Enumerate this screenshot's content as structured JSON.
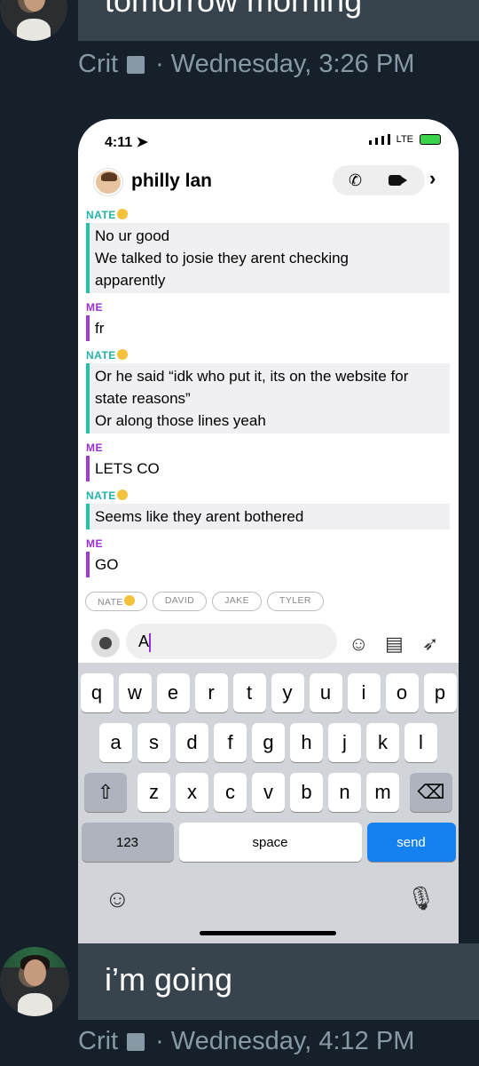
{
  "prev_message": {
    "text": "tomorrow morning"
  },
  "prev_meta": {
    "name": "Crit",
    "separator": "·",
    "timestamp": "Wednesday, 3:26 PM"
  },
  "phone": {
    "status": {
      "time": "4:11",
      "network": "LTE"
    },
    "chat": {
      "title": "philly lan"
    },
    "messages": [
      {
        "sender": "NATE",
        "lines": [
          "No ur good",
          "We talked to josie they arent checking",
          "apparently"
        ]
      },
      {
        "sender": "ME",
        "lines": [
          "fr"
        ]
      },
      {
        "sender": "NATE",
        "lines": [
          "Or he said “idk who put it, its on the website for",
          "state reasons”",
          "Or along those lines yeah"
        ]
      },
      {
        "sender": "ME",
        "lines": [
          "LETS CO"
        ]
      },
      {
        "sender": "NATE",
        "lines": [
          "Seems like they arent bothered"
        ]
      },
      {
        "sender": "ME",
        "lines": [
          "GO"
        ]
      }
    ],
    "mention_pills": [
      "NATE",
      "DAVID",
      "JAKE",
      "TYLER"
    ],
    "input": {
      "value": "A"
    },
    "keyboard": {
      "row1": [
        "q",
        "w",
        "e",
        "r",
        "t",
        "y",
        "u",
        "i",
        "o",
        "p"
      ],
      "row2": [
        "a",
        "s",
        "d",
        "f",
        "g",
        "h",
        "j",
        "k",
        "l"
      ],
      "row3": [
        "z",
        "x",
        "c",
        "v",
        "b",
        "n",
        "m"
      ],
      "num_label": "123",
      "space_label": "space",
      "send_label": "send"
    }
  },
  "reply_message": {
    "text": "i’m going"
  },
  "reply_meta": {
    "name": "Crit",
    "separator": "·",
    "timestamp": "Wednesday, 4:12 PM"
  },
  "colors": {
    "background": "#15202b",
    "bubble": "#38444d",
    "meta": "#8899a6",
    "nate": "#22b3a8",
    "me": "#9a2fd1",
    "send": "#1580f0"
  }
}
